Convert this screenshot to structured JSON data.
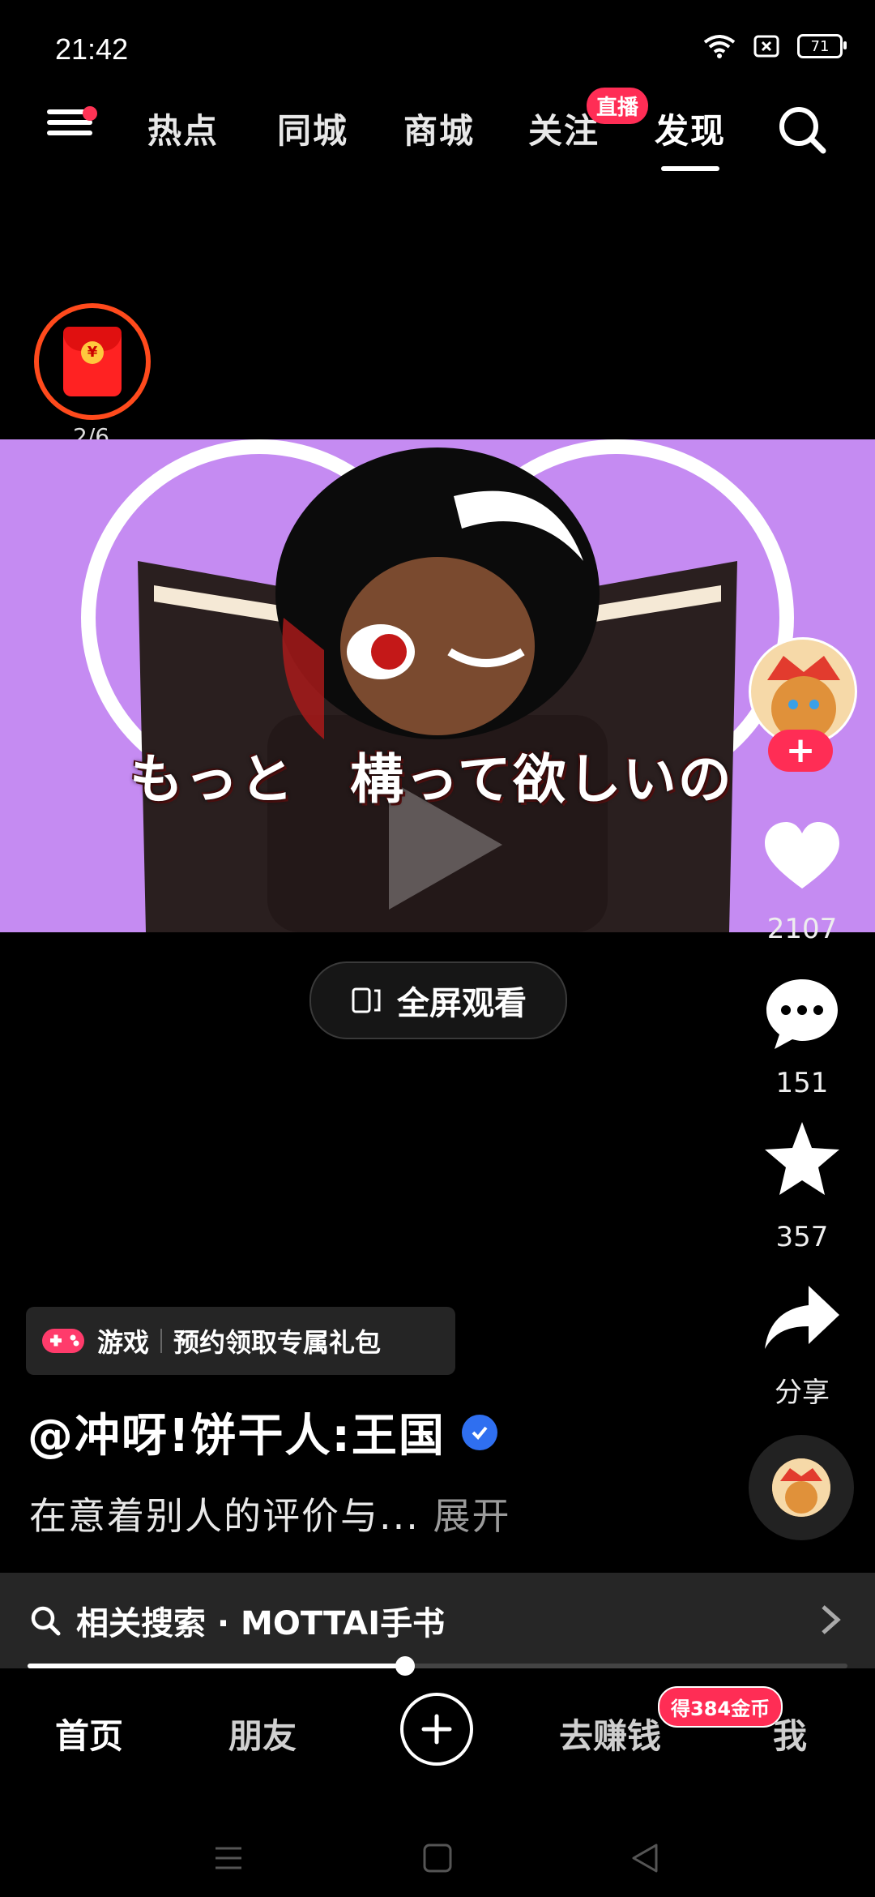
{
  "status": {
    "time": "21:42",
    "battery": "71"
  },
  "topnav": {
    "tabs": [
      "热点",
      "同城",
      "商城",
      "关注",
      "发现"
    ],
    "live_badge": "直播"
  },
  "redpacket": {
    "count": "2/6"
  },
  "video": {
    "subtitle": "もっと　構って欲しいの"
  },
  "fullscreen": {
    "label": "全屏观看"
  },
  "sidebar": {
    "likes": "2107",
    "comments": "151",
    "favorites": "357",
    "share": "分享"
  },
  "caption": {
    "tag_type": "游戏",
    "tag_text": "预约领取专属礼包",
    "author": "@冲呀!饼干人:王国",
    "desc": "在意着别人的评价与...",
    "more": "展开"
  },
  "related": {
    "text": "相关搜索 · MOTTAI手书"
  },
  "progress": {
    "fraction": 0.46
  },
  "bottomnav": {
    "home": "首页",
    "friends": "朋友",
    "earn": "去赚钱",
    "me": "我",
    "coin_badge": "得384金币"
  },
  "colors": {
    "accent": "#ff2d55",
    "video_bg": "#c58bf2",
    "verified": "#2f6ff0"
  },
  "icons": [
    "menu-icon",
    "search-icon",
    "heart-icon",
    "comment-icon",
    "star-icon",
    "share-icon",
    "plus-icon",
    "gamepad-icon",
    "fullscreen-icon",
    "chevron-right-icon"
  ]
}
